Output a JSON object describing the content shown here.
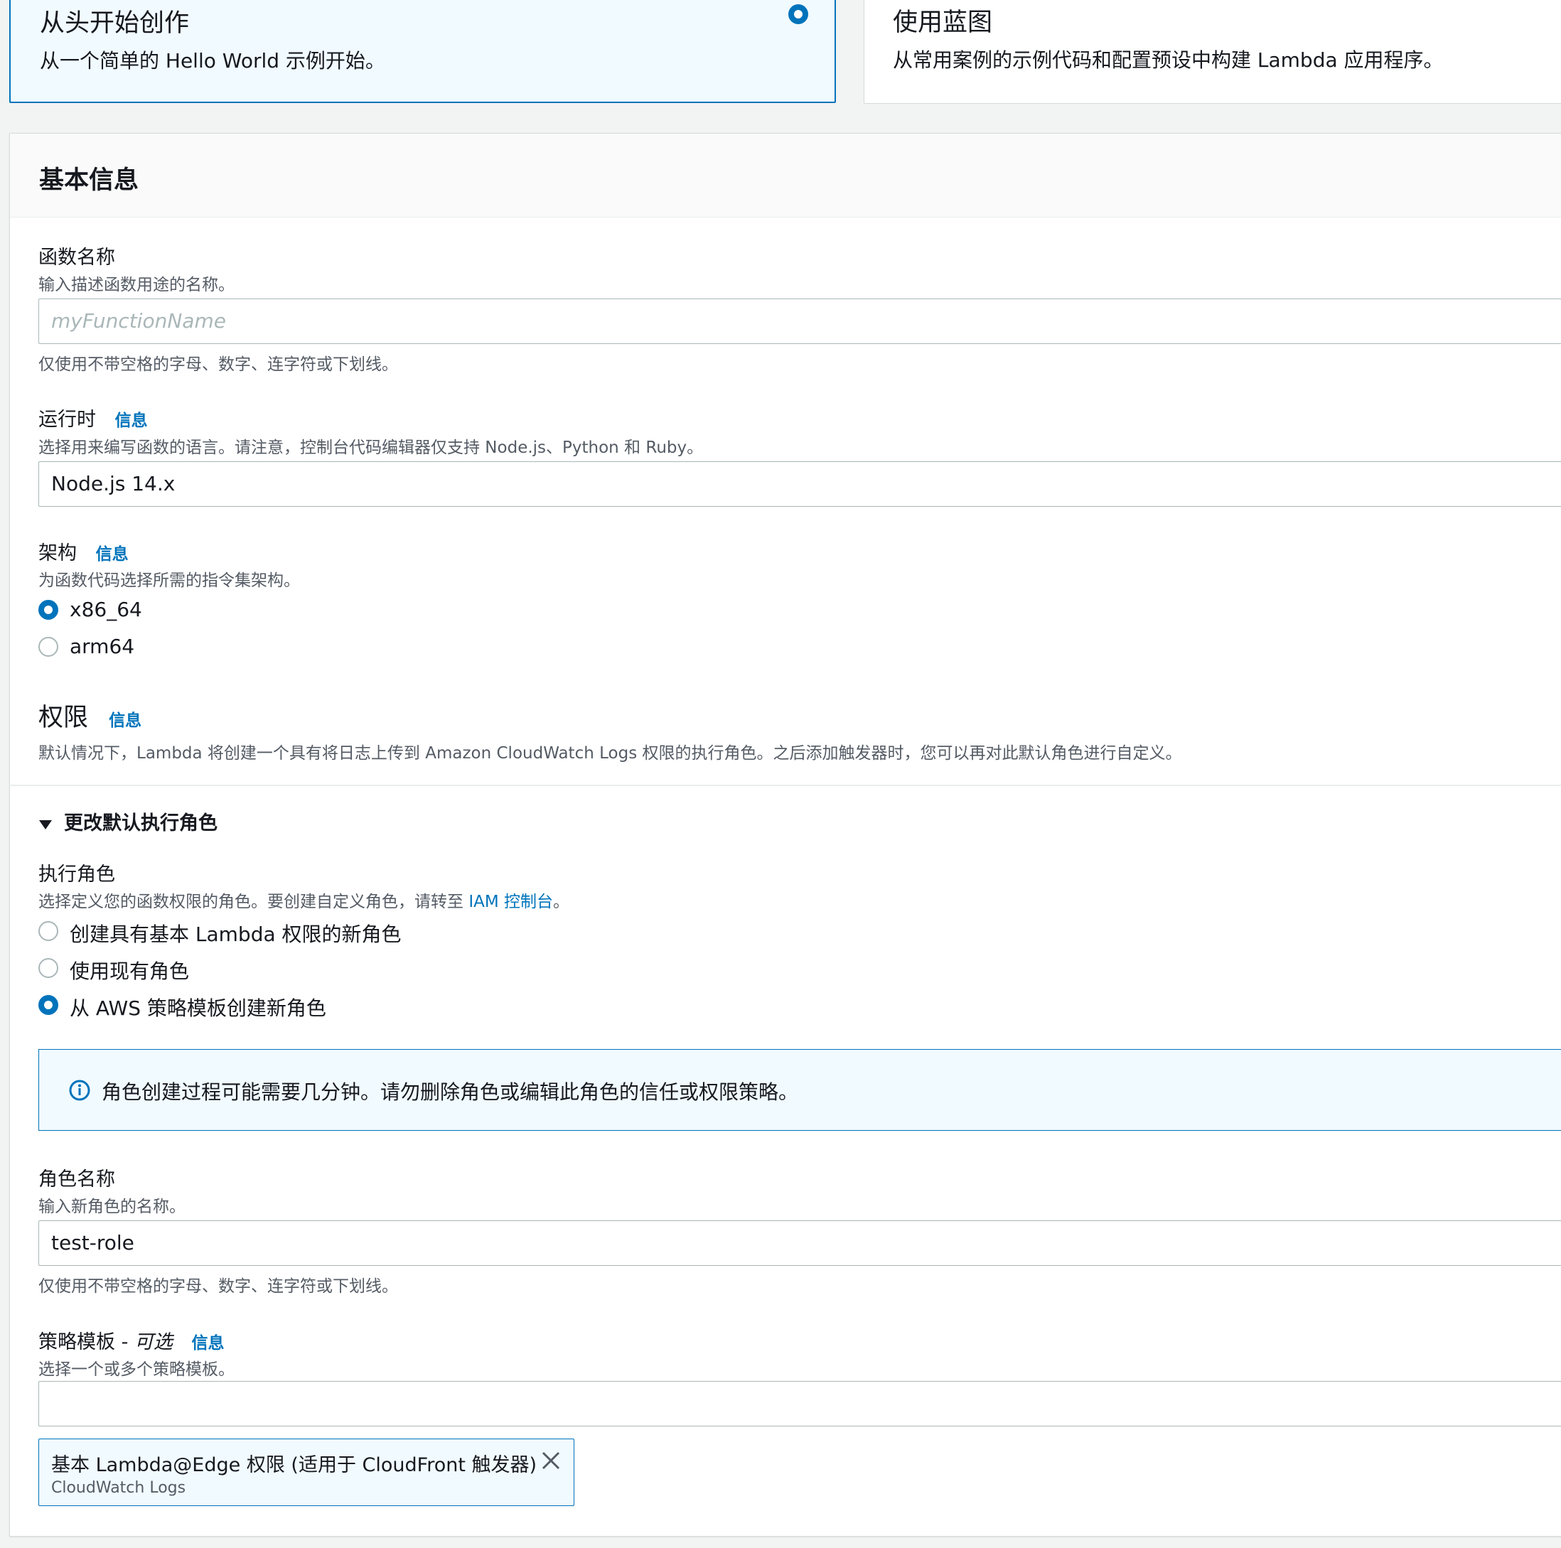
{
  "options": {
    "scratch": {
      "title": "从头开始创作",
      "desc": "从一个简单的 Hello World 示例开始。"
    },
    "blueprint": {
      "title": "使用蓝图",
      "desc": "从常用案例的示例代码和配置预设中构建 Lambda 应用程序。"
    }
  },
  "basic": {
    "header": "基本信息",
    "function_name": {
      "label": "函数名称",
      "desc": "输入描述函数用途的名称。",
      "placeholder": "myFunctionName",
      "hint": "仅使用不带空格的字母、数字、连字符或下划线。"
    },
    "runtime": {
      "label": "运行时",
      "info": "信息",
      "desc": "选择用来编写函数的语言。请注意，控制台代码编辑器仅支持 Node.js、Python 和 Ruby。",
      "value": "Node.js 14.x"
    },
    "arch": {
      "label": "架构",
      "info": "信息",
      "desc": "为函数代码选择所需的指令集架构。",
      "options": [
        "x86_64",
        "arm64"
      ]
    },
    "permissions": {
      "title": "权限",
      "info": "信息",
      "desc": "默认情况下，Lambda 将创建一个具有将日志上传到 Amazon CloudWatch Logs 权限的执行角色。之后添加触发器时，您可以再对此默认角色进行自定义。"
    },
    "change_role": {
      "toggle_label": "更改默认执行角色",
      "exec_label": "执行角色",
      "exec_desc_prefix": "选择定义您的函数权限的角色。要创建自定义角色，请转至 ",
      "exec_desc_link": "IAM 控制台",
      "exec_desc_suffix": "。",
      "options": [
        "创建具有基本 Lambda 权限的新角色",
        "使用现有角色",
        "从 AWS 策略模板创建新角色"
      ],
      "alert": "角色创建过程可能需要几分钟。请勿删除角色或编辑此角色的信任或权限策略。"
    },
    "role_name": {
      "label": "角色名称",
      "desc": "输入新角色的名称。",
      "value": "test-role",
      "hint": "仅使用不带空格的字母、数字、连字符或下划线。"
    },
    "policy": {
      "label": "策略模板 - ",
      "optional": "可选",
      "info": "信息",
      "desc": "选择一个或多个策略模板。",
      "token_title": "基本 Lambda@Edge 权限 (适用于 CloudFront 触发器)",
      "token_sub": "CloudWatch Logs"
    }
  },
  "colors": {
    "accent": "#0073bb",
    "selected_bg": "#f1faff",
    "border": "#aab7b8",
    "muted_text": "#545b64"
  }
}
